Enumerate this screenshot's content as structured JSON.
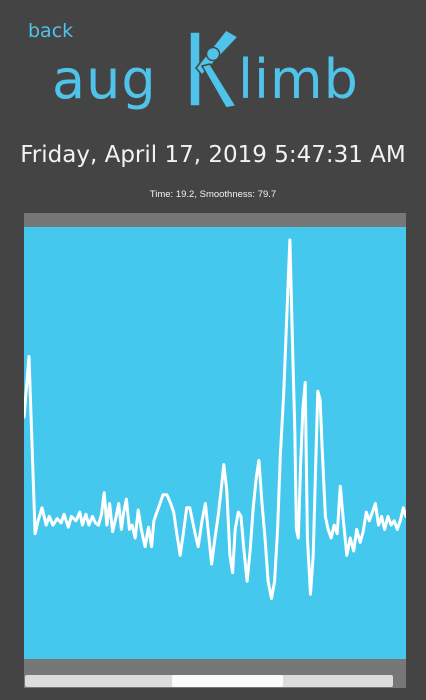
{
  "nav": {
    "back_label": "back"
  },
  "logo": {
    "left_text": "aug",
    "right_text": "limb"
  },
  "session": {
    "datetime": "Friday, April 17, 2019 5:47:31 AM",
    "stats": "Time: 19.2,  Smoothness: 79.7"
  },
  "colors": {
    "background": "#444444",
    "accent": "#4fc3e9",
    "plot_background": "#45c8ee",
    "frame": "#777777",
    "trace": "#ffffff"
  },
  "chart_data": {
    "type": "line",
    "title": "",
    "xlabel": "",
    "ylabel": "",
    "grid": false,
    "legend": "none",
    "xlim": [
      0,
      1
    ],
    "ylim": [
      0,
      1
    ],
    "series": [
      {
        "values": [
          [
            0.0,
            0.56
          ],
          [
            0.013,
            0.7
          ],
          [
            0.029,
            0.29
          ],
          [
            0.037,
            0.32
          ],
          [
            0.047,
            0.35
          ],
          [
            0.058,
            0.31
          ],
          [
            0.066,
            0.33
          ],
          [
            0.076,
            0.31
          ],
          [
            0.087,
            0.325
          ],
          [
            0.097,
            0.315
          ],
          [
            0.105,
            0.335
          ],
          [
            0.116,
            0.305
          ],
          [
            0.124,
            0.33
          ],
          [
            0.136,
            0.32
          ],
          [
            0.146,
            0.34
          ],
          [
            0.153,
            0.31
          ],
          [
            0.162,
            0.335
          ],
          [
            0.17,
            0.31
          ],
          [
            0.179,
            0.33
          ],
          [
            0.187,
            0.315
          ],
          [
            0.195,
            0.31
          ],
          [
            0.203,
            0.335
          ],
          [
            0.21,
            0.385
          ],
          [
            0.217,
            0.31
          ],
          [
            0.224,
            0.36
          ],
          [
            0.232,
            0.295
          ],
          [
            0.24,
            0.325
          ],
          [
            0.248,
            0.36
          ],
          [
            0.255,
            0.3
          ],
          [
            0.261,
            0.34
          ],
          [
            0.268,
            0.37
          ],
          [
            0.276,
            0.3
          ],
          [
            0.283,
            0.31
          ],
          [
            0.291,
            0.28
          ],
          [
            0.299,
            0.345
          ],
          [
            0.307,
            0.3
          ],
          [
            0.317,
            0.26
          ],
          [
            0.326,
            0.305
          ],
          [
            0.334,
            0.26
          ],
          [
            0.34,
            0.32
          ],
          [
            0.348,
            0.34
          ],
          [
            0.356,
            0.36
          ],
          [
            0.364,
            0.38
          ],
          [
            0.374,
            0.38
          ],
          [
            0.384,
            0.36
          ],
          [
            0.392,
            0.34
          ],
          [
            0.4,
            0.29
          ],
          [
            0.409,
            0.24
          ],
          [
            0.417,
            0.29
          ],
          [
            0.426,
            0.35
          ],
          [
            0.434,
            0.35
          ],
          [
            0.441,
            0.32
          ],
          [
            0.448,
            0.29
          ],
          [
            0.456,
            0.26
          ],
          [
            0.466,
            0.32
          ],
          [
            0.475,
            0.36
          ],
          [
            0.483,
            0.29
          ],
          [
            0.491,
            0.22
          ],
          [
            0.5,
            0.28
          ],
          [
            0.508,
            0.33
          ],
          [
            0.516,
            0.39
          ],
          [
            0.523,
            0.45
          ],
          [
            0.531,
            0.39
          ],
          [
            0.539,
            0.24
          ],
          [
            0.546,
            0.2
          ],
          [
            0.553,
            0.3
          ],
          [
            0.561,
            0.34
          ],
          [
            0.568,
            0.33
          ],
          [
            0.576,
            0.25
          ],
          [
            0.584,
            0.18
          ],
          [
            0.592,
            0.25
          ],
          [
            0.6,
            0.35
          ],
          [
            0.608,
            0.42
          ],
          [
            0.615,
            0.46
          ],
          [
            0.623,
            0.36
          ],
          [
            0.631,
            0.28
          ],
          [
            0.639,
            0.18
          ],
          [
            0.648,
            0.14
          ],
          [
            0.656,
            0.18
          ],
          [
            0.664,
            0.3
          ],
          [
            0.671,
            0.47
          ],
          [
            0.68,
            0.62
          ],
          [
            0.69,
            0.84
          ],
          [
            0.696,
            0.97
          ],
          [
            0.703,
            0.73
          ],
          [
            0.709,
            0.53
          ],
          [
            0.713,
            0.3
          ],
          [
            0.718,
            0.28
          ],
          [
            0.724,
            0.45
          ],
          [
            0.73,
            0.58
          ],
          [
            0.736,
            0.64
          ],
          [
            0.742,
            0.28
          ],
          [
            0.75,
            0.15
          ],
          [
            0.757,
            0.24
          ],
          [
            0.762,
            0.4
          ],
          [
            0.769,
            0.62
          ],
          [
            0.775,
            0.6
          ],
          [
            0.781,
            0.48
          ],
          [
            0.789,
            0.33
          ],
          [
            0.796,
            0.3
          ],
          [
            0.804,
            0.28
          ],
          [
            0.812,
            0.31
          ],
          [
            0.82,
            0.29
          ],
          [
            0.828,
            0.4
          ],
          [
            0.836,
            0.32
          ],
          [
            0.845,
            0.24
          ],
          [
            0.854,
            0.28
          ],
          [
            0.863,
            0.25
          ],
          [
            0.871,
            0.3
          ],
          [
            0.88,
            0.27
          ],
          [
            0.888,
            0.295
          ],
          [
            0.896,
            0.34
          ],
          [
            0.904,
            0.32
          ],
          [
            0.912,
            0.34
          ],
          [
            0.92,
            0.36
          ],
          [
            0.928,
            0.31
          ],
          [
            0.936,
            0.33
          ],
          [
            0.944,
            0.3
          ],
          [
            0.953,
            0.33
          ],
          [
            0.961,
            0.31
          ],
          [
            0.969,
            0.32
          ],
          [
            0.977,
            0.3
          ],
          [
            0.985,
            0.32
          ],
          [
            0.993,
            0.35
          ],
          [
            1.0,
            0.33
          ]
        ]
      }
    ]
  },
  "scroll": {
    "thumb_start": 0.4,
    "thumb_size": 0.3
  }
}
